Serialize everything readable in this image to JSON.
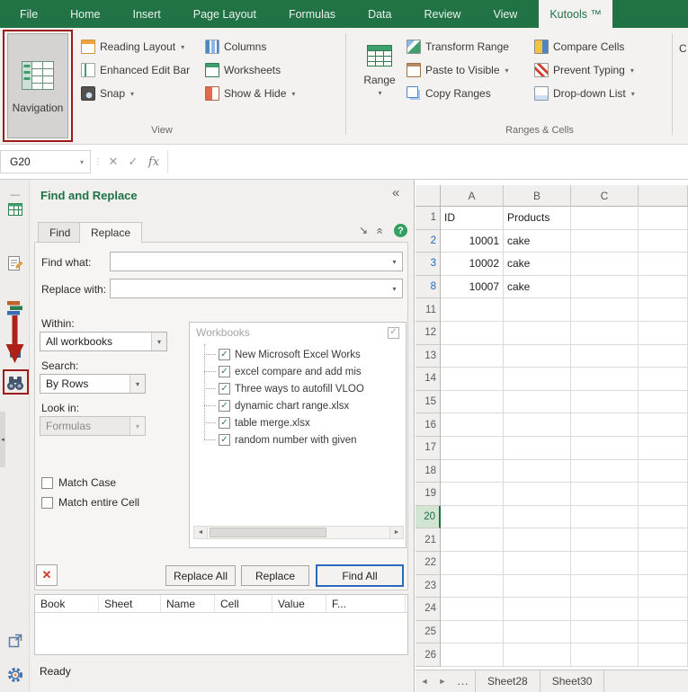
{
  "glyphs": {
    "caret": "▾",
    "dots": "⋮",
    "cancel": "✕",
    "enter": "✓",
    "fx": "fx",
    "collapse_pane": "«",
    "dock": "↘",
    "help": "?",
    "check": "✓",
    "scroll_left": "◄",
    "scroll_right": "►",
    "overflow": "...",
    "menu_dash": "—",
    "edge_handle": "◂"
  },
  "ribbon": {
    "tabs": [
      {
        "label": "File",
        "active": false
      },
      {
        "label": "Home",
        "active": false
      },
      {
        "label": "Insert",
        "active": false
      },
      {
        "label": "Page Layout",
        "active": false
      },
      {
        "label": "Formulas",
        "active": false
      },
      {
        "label": "Data",
        "active": false
      },
      {
        "label": "Review",
        "active": false
      },
      {
        "label": "View",
        "active": false
      },
      {
        "label": "Kutools ™",
        "active": true
      }
    ],
    "navigation_label": "Navigation",
    "view_group": {
      "label": "View",
      "col1": [
        {
          "label": "Reading Layout",
          "dropdown": true,
          "icon": "reading-layout"
        },
        {
          "label": "Enhanced Edit Bar",
          "dropdown": false,
          "icon": "enhanced-edit-bar"
        },
        {
          "label": "Snap",
          "dropdown": true,
          "icon": "snap"
        }
      ],
      "col2": [
        {
          "label": "Columns",
          "dropdown": false,
          "icon": "columns"
        },
        {
          "label": "Worksheets",
          "dropdown": false,
          "icon": "worksheets"
        },
        {
          "label": "Show & Hide",
          "dropdown": true,
          "icon": "show-hide"
        }
      ]
    },
    "range_button": {
      "label": "Range"
    },
    "ranges_group": {
      "label": "Ranges & Cells",
      "col1": [
        {
          "label": "Transform Range",
          "dropdown": false,
          "icon": "transform-range"
        },
        {
          "label": "Paste to Visible",
          "dropdown": true,
          "icon": "paste-to-visible"
        },
        {
          "label": "Copy Ranges",
          "dropdown": false,
          "icon": "copy-ranges"
        }
      ],
      "col2": [
        {
          "label": "Compare Cells",
          "dropdown": false,
          "icon": "compare-cells"
        },
        {
          "label": "Prevent Typing",
          "dropdown": true,
          "icon": "prevent-typing"
        },
        {
          "label": "Drop-down List",
          "dropdown": true,
          "icon": "drop-down-list"
        }
      ]
    },
    "clipped_label": "C"
  },
  "formula_bar": {
    "name_box": "G20",
    "formula_value": ""
  },
  "pane": {
    "title": "Find and Replace",
    "tabs": [
      {
        "label": "Find",
        "active": false
      },
      {
        "label": "Replace",
        "active": true
      }
    ],
    "fields": {
      "find_what": {
        "label": "Find what:",
        "value": ""
      },
      "replace_with": {
        "label": "Replace with:",
        "value": ""
      },
      "within": {
        "label": "Within:",
        "value": "All workbooks"
      },
      "search": {
        "label": "Search:",
        "value": "By Rows"
      },
      "look_in": {
        "label": "Look in:",
        "value": "Formulas"
      }
    },
    "checkboxes": [
      {
        "label": "Match Case",
        "checked": false
      },
      {
        "label": "Match entire Cell",
        "checked": false
      }
    ],
    "workbooks": {
      "label": "Workbooks",
      "items": [
        {
          "label": "New Microsoft Excel Works",
          "checked": true
        },
        {
          "label": "excel compare and add mis",
          "checked": true
        },
        {
          "label": "Three ways to autofill VLOO",
          "checked": true
        },
        {
          "label": "dynamic chart range.xlsx",
          "checked": true
        },
        {
          "label": "table merge.xlsx",
          "checked": true
        },
        {
          "label": "random number with given",
          "checked": true
        }
      ]
    },
    "buttons": {
      "delete": "✕",
      "replace_all": "Replace All",
      "replace": "Replace",
      "find_all": "Find All"
    },
    "results_columns": [
      "Book",
      "Sheet",
      "Name",
      "Cell",
      "Value",
      "F..."
    ],
    "status": "Ready"
  },
  "spreadsheet": {
    "columns": [
      "A",
      "B",
      "C"
    ],
    "rows": [
      {
        "n": "1",
        "a": "ID",
        "b": "Products"
      },
      {
        "n": "2",
        "a": "10001",
        "b": "cake",
        "num_style": "filtered",
        "a_align": "right"
      },
      {
        "n": "3",
        "a": "10002",
        "b": "cake",
        "num_style": "filtered",
        "a_align": "right"
      },
      {
        "n": "8",
        "a": "10007",
        "b": "cake",
        "num_style": "filtered",
        "a_align": "right"
      },
      {
        "n": "11"
      },
      {
        "n": "12"
      },
      {
        "n": "13"
      },
      {
        "n": "14"
      },
      {
        "n": "15"
      },
      {
        "n": "16"
      },
      {
        "n": "17"
      },
      {
        "n": "18"
      },
      {
        "n": "19"
      },
      {
        "n": "20",
        "num_style": "active"
      },
      {
        "n": "21"
      },
      {
        "n": "22"
      },
      {
        "n": "23"
      },
      {
        "n": "24"
      },
      {
        "n": "25"
      },
      {
        "n": "26"
      }
    ]
  },
  "sheet_bar": {
    "tabs": [
      "Sheet28",
      "Sheet30"
    ]
  }
}
